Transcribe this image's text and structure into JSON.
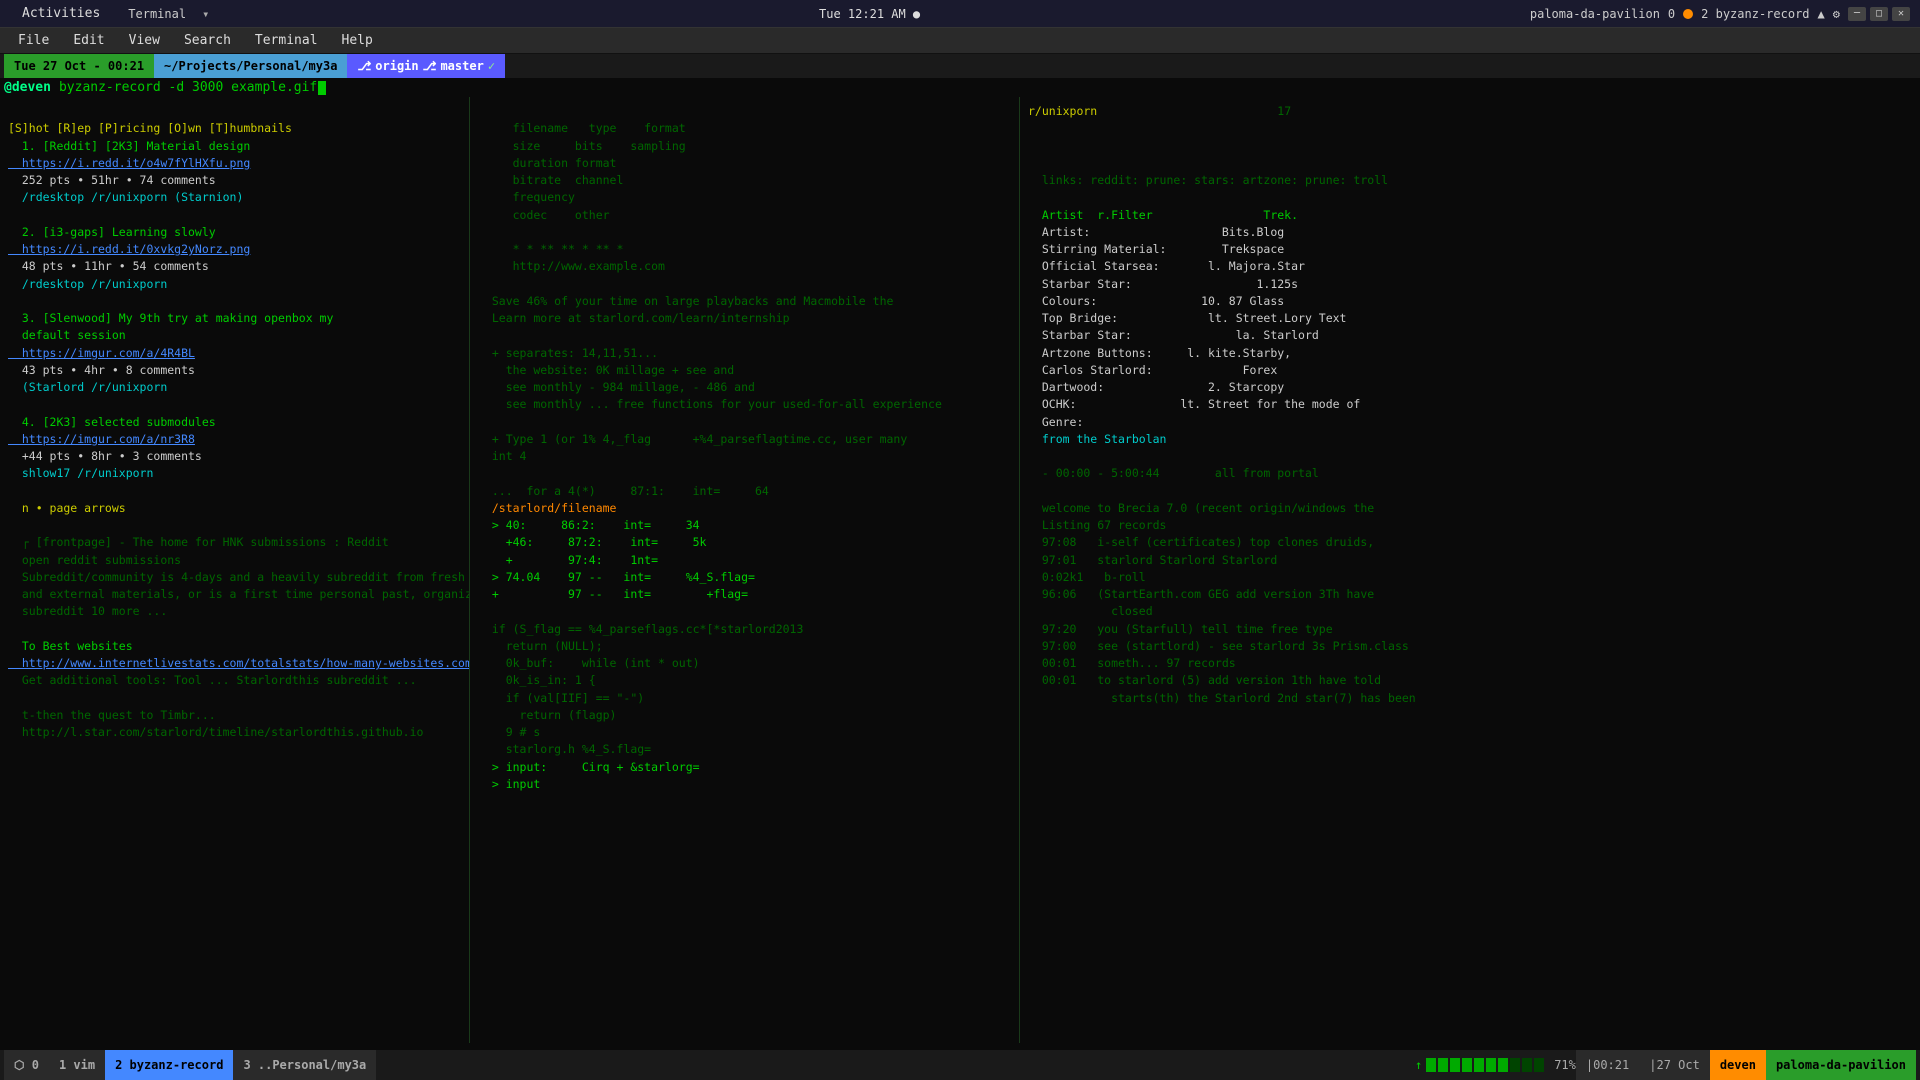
{
  "system_bar": {
    "activities": "Activities",
    "terminal_label": "Terminal",
    "datetime": "Tue 12:21 AM ●",
    "hostname": "paloma-da-pavilion",
    "tmux_pane_0": "0",
    "tmux_dot": "●",
    "tmux_session": "2 byzanz-record"
  },
  "menu": {
    "items": [
      "File",
      "Edit",
      "View",
      "Search",
      "Terminal",
      "Help"
    ]
  },
  "prompt": {
    "date": "Tue 27 Oct - 00:21",
    "dir": "~/Projects/Personal/my3a",
    "branch_icon": "⎇",
    "origin": "origin",
    "branch": "master",
    "check": "✓"
  },
  "command": {
    "user": "@deven",
    "cmd": "byzanz-record -d 3000 example.gif"
  },
  "status_bar": {
    "pane0": "⬡ 0",
    "pane1": "1 vim",
    "pane2": "2 byzanz-record",
    "pane3": "3 ..Personal/my3a",
    "battery_pct": "71%",
    "time": "00:21",
    "date": "27 Oct",
    "user": "deven",
    "host": "paloma-da-pavilion"
  },
  "icons": {
    "wifi": "▲",
    "battery": "🔋",
    "settings": "⚙"
  }
}
